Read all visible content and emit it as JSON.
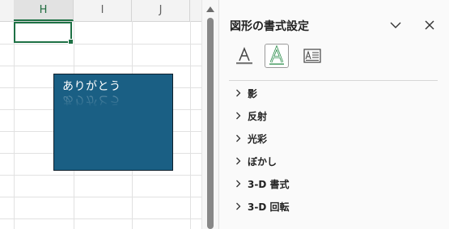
{
  "sheet": {
    "columns": [
      "H",
      "I",
      "J"
    ],
    "shape_text": "ありがとう"
  },
  "pane": {
    "title": "図形の書式設定",
    "tabs": [
      {
        "icon": "text-fill-outline-icon"
      },
      {
        "icon": "text-effects-icon"
      },
      {
        "icon": "textbox-icon"
      }
    ],
    "sections": [
      {
        "label": "影"
      },
      {
        "label": "反射"
      },
      {
        "label": "光彩"
      },
      {
        "label": "ぼかし"
      },
      {
        "label": "3-D 書式"
      },
      {
        "label": "3-D 回転"
      }
    ]
  },
  "colors": {
    "selected_green": "#1e7145",
    "shape_fill": "#1a5f84",
    "shape_border": "#0f1f2b"
  }
}
